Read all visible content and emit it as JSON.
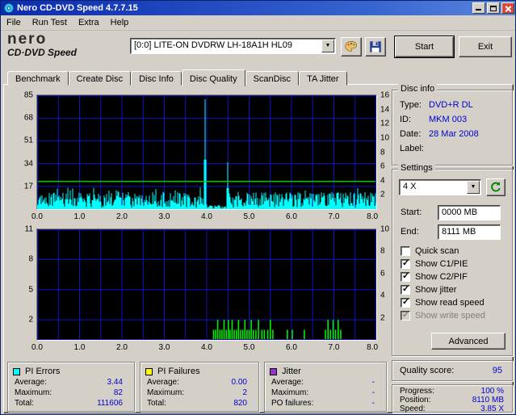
{
  "window": {
    "title": "Nero CD-DVD Speed 4.7.7.15"
  },
  "menu": {
    "items": [
      "File",
      "Run Test",
      "Extra",
      "Help"
    ]
  },
  "logo": {
    "brand": "nero",
    "product": "CD·DVD Speed"
  },
  "toolbar": {
    "drive_selector": "[0:0]  LITE-ON DVDRW LH-18A1H HL09",
    "start_label": "Start",
    "exit_label": "Exit"
  },
  "tabs": {
    "items": [
      "Benchmark",
      "Create Disc",
      "Disc Info",
      "Disc Quality",
      "ScanDisc",
      "TA Jitter"
    ],
    "active": "Disc Quality"
  },
  "disc_info": {
    "title": "Disc info",
    "rows": [
      {
        "label": "Type:",
        "value": "DVD+R DL"
      },
      {
        "label": "ID:",
        "value": "MKM 003"
      },
      {
        "label": "Date:",
        "value": "28 Mar 2008"
      },
      {
        "label": "Label:",
        "value": ""
      }
    ]
  },
  "settings": {
    "title": "Settings",
    "speed": "4 X",
    "start_label": "Start:",
    "start_value": "0000 MB",
    "end_label": "End:",
    "end_value": "8111 MB",
    "checkboxes": [
      {
        "label": "Quick scan",
        "checked": false,
        "enabled": true
      },
      {
        "label": "Show C1/PIE",
        "checked": true,
        "enabled": true
      },
      {
        "label": "Show C2/PIF",
        "checked": true,
        "enabled": true
      },
      {
        "label": "Show jitter",
        "checked": true,
        "enabled": true
      },
      {
        "label": "Show read speed",
        "checked": true,
        "enabled": true
      },
      {
        "label": "Show write speed",
        "checked": true,
        "enabled": false
      }
    ],
    "advanced_label": "Advanced"
  },
  "quality": {
    "label": "Quality score:",
    "value": "95"
  },
  "progress": {
    "rows": [
      {
        "label": "Progress:",
        "value": "100 %"
      },
      {
        "label": "Position:",
        "value": "8110 MB"
      },
      {
        "label": "Speed:",
        "value": "3.85 X"
      }
    ]
  },
  "legends": [
    {
      "title": "PI Errors",
      "color": "#00FFFF",
      "rows": [
        {
          "label": "Average:",
          "value": "3.44"
        },
        {
          "label": "Maximum:",
          "value": "82"
        },
        {
          "label": "Total:",
          "value": "111606"
        }
      ]
    },
    {
      "title": "PI Failures",
      "color": "#FFFF00",
      "rows": [
        {
          "label": "Average:",
          "value": "0.00"
        },
        {
          "label": "Maximum:",
          "value": "2"
        },
        {
          "label": "Total:",
          "value": "820"
        }
      ]
    },
    {
      "title": "Jitter",
      "color": "#9933CC",
      "rows": [
        {
          "label": "Average:",
          "value": "-"
        },
        {
          "label": "Maximum:",
          "value": "-"
        },
        {
          "label": "PO failures:",
          "value": "-"
        }
      ]
    }
  ],
  "chart_data": [
    {
      "type": "area",
      "title": "PI Errors",
      "x_range": [
        0,
        8
      ],
      "x_grid_step": 0.5,
      "x_ticks": [
        "0.0",
        "1.0",
        "2.0",
        "3.0",
        "4.0",
        "5.0",
        "6.0",
        "7.0",
        "8.0"
      ],
      "left_axis": {
        "max": 85,
        "ticks": [
          85,
          68,
          51,
          34,
          17
        ]
      },
      "right_axis": {
        "max": 16,
        "ticks": [
          16,
          14,
          12,
          10,
          8,
          6,
          4,
          2
        ]
      },
      "grid_color": "#1212BE",
      "series": [
        {
          "name": "PI Errors",
          "style": "noise-fill",
          "color": "#00FFFF",
          "base_range": [
            1,
            13
          ],
          "quiet_zones": [
            [
              4.03,
              4.46,
              0.3,
              3.0
            ]
          ],
          "spikes": [
            {
              "x": 3.97,
              "value": 82
            },
            {
              "x": 4.5,
              "value": 35
            }
          ],
          "stats": {
            "average": 3.44,
            "maximum": 82,
            "total": 111606
          }
        },
        {
          "name": "Read speed",
          "style": "hline-right-axis",
          "color": "#00CC00",
          "value": 3.9
        }
      ]
    },
    {
      "type": "bar",
      "title": "PI Failures",
      "x_range": [
        0,
        8
      ],
      "x_grid_step": 0.5,
      "x_ticks": [
        "0.0",
        "1.0",
        "2.0",
        "3.0",
        "4.0",
        "5.0",
        "6.0",
        "7.0",
        "8.0"
      ],
      "left_axis": {
        "max": 11,
        "ticks": [
          11,
          8,
          5,
          2
        ]
      },
      "right_axis": {
        "max": 10,
        "ticks": [
          10,
          8,
          6,
          4,
          2
        ]
      },
      "grid_color": "#1212BE",
      "series": [
        {
          "name": "PI Failures",
          "style": "bars",
          "color": "#00EE00",
          "bars": [
            [
              4.16,
              1
            ],
            [
              4.21,
              1
            ],
            [
              4.26,
              2
            ],
            [
              4.31,
              1
            ],
            [
              4.36,
              1
            ],
            [
              4.41,
              2
            ],
            [
              4.46,
              1
            ],
            [
              4.51,
              2
            ],
            [
              4.55,
              1
            ],
            [
              4.6,
              2
            ],
            [
              4.65,
              1
            ],
            [
              4.7,
              1
            ],
            [
              4.75,
              2
            ],
            [
              4.8,
              1
            ],
            [
              4.85,
              1
            ],
            [
              4.9,
              2
            ],
            [
              4.95,
              1
            ],
            [
              5.0,
              1
            ],
            [
              5.05,
              2
            ],
            [
              5.1,
              1
            ],
            [
              5.16,
              1
            ],
            [
              5.22,
              2
            ],
            [
              5.3,
              1
            ],
            [
              5.36,
              1
            ],
            [
              5.44,
              1
            ],
            [
              5.5,
              2
            ],
            [
              5.56,
              1
            ],
            [
              5.9,
              1
            ],
            [
              6.02,
              1
            ],
            [
              6.3,
              1
            ],
            [
              6.8,
              1
            ],
            [
              6.86,
              2
            ],
            [
              6.92,
              1
            ],
            [
              6.98,
              2
            ],
            [
              7.04,
              1
            ],
            [
              7.1,
              2
            ],
            [
              7.16,
              1
            ]
          ],
          "stats": {
            "average": 0.0,
            "maximum": 2,
            "total": 820
          }
        }
      ]
    }
  ]
}
